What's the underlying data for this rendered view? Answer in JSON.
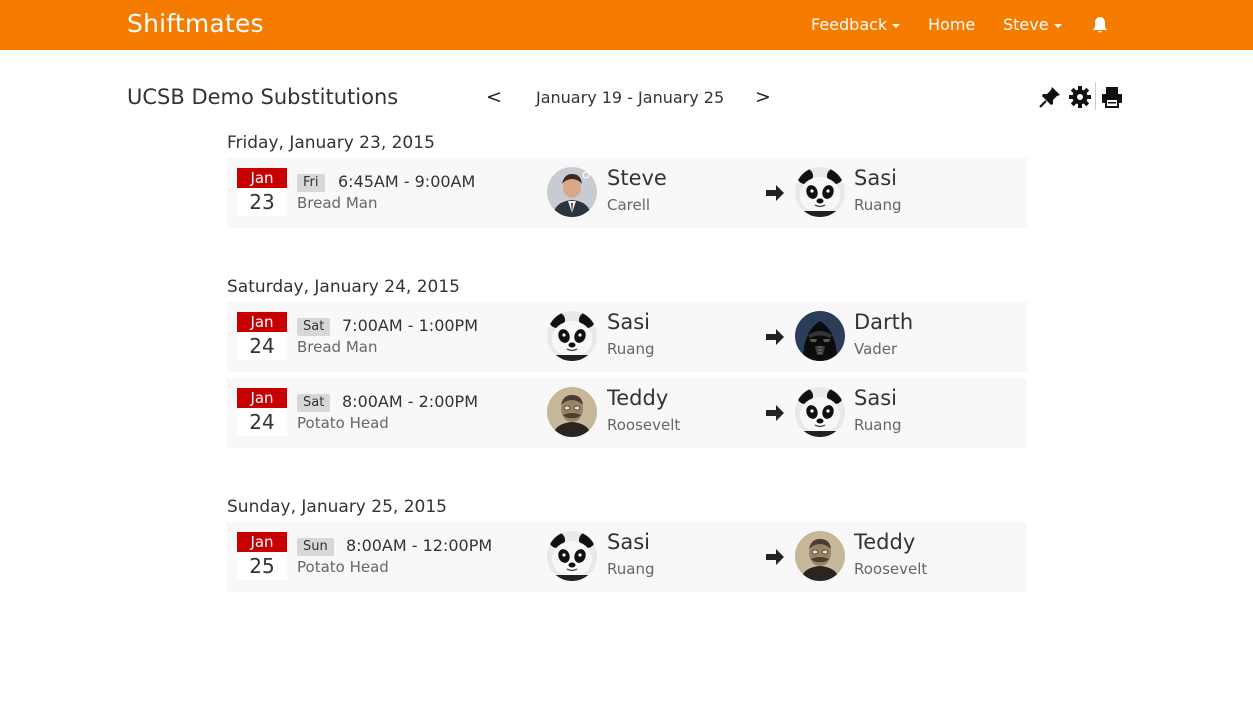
{
  "navbar": {
    "brand": "Shiftmates",
    "feedback": "Feedback",
    "home": "Home",
    "user": "Steve"
  },
  "header": {
    "title": "UCSB Demo Substitutions",
    "prev": "<",
    "next": ">",
    "week_range": "January 19 - January 25"
  },
  "days": [
    {
      "heading": "Friday, January 23, 2015",
      "shifts": [
        {
          "month": "Jan",
          "day": "23",
          "dow": "Fri",
          "time": "6:45AM - 9:00AM",
          "job": "Bread Man",
          "from": {
            "first": "Steve",
            "last": "Carell",
            "avatar": "person-photo"
          },
          "to": {
            "first": "Sasi",
            "last": "Ruang",
            "avatar": "panda"
          }
        }
      ]
    },
    {
      "heading": "Saturday, January 24, 2015",
      "shifts": [
        {
          "month": "Jan",
          "day": "24",
          "dow": "Sat",
          "time": "7:00AM - 1:00PM",
          "job": "Bread Man",
          "from": {
            "first": "Sasi",
            "last": "Ruang",
            "avatar": "panda"
          },
          "to": {
            "first": "Darth",
            "last": "Vader",
            "avatar": "vader"
          }
        },
        {
          "month": "Jan",
          "day": "24",
          "dow": "Sat",
          "time": "8:00AM - 2:00PM",
          "job": "Potato Head",
          "from": {
            "first": "Teddy",
            "last": "Roosevelt",
            "avatar": "roosevelt"
          },
          "to": {
            "first": "Sasi",
            "last": "Ruang",
            "avatar": "panda"
          }
        }
      ]
    },
    {
      "heading": "Sunday, January 25, 2015",
      "shifts": [
        {
          "month": "Jan",
          "day": "25",
          "dow": "Sun",
          "time": "8:00AM - 12:00PM",
          "job": "Potato Head",
          "from": {
            "first": "Sasi",
            "last": "Ruang",
            "avatar": "panda"
          },
          "to": {
            "first": "Teddy",
            "last": "Roosevelt",
            "avatar": "roosevelt"
          }
        }
      ]
    }
  ],
  "icons": {
    "bell": "bell-icon",
    "pin": "pin-icon",
    "settings": "gear-icon",
    "print": "print-icon",
    "arrow": "arrow-right-icon"
  },
  "colors": {
    "navbar": "#f57c00",
    "calendar_month": "#c60000",
    "row_background": "#f8f8f8",
    "day_badge": "#d7d7d7"
  }
}
